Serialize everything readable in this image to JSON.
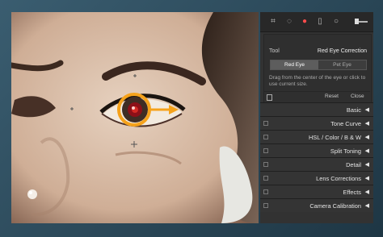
{
  "toolbar": {
    "icons": [
      "crop-grid-icon",
      "spot-removal-icon",
      "red-eye-icon",
      "graduated-filter-icon",
      "radial-filter-icon",
      "adjustment-brush-icon"
    ]
  },
  "tool": {
    "label": "Tool",
    "value": "Red Eye Correction",
    "modes": [
      "Red Eye",
      "Pet Eye"
    ],
    "help": "Drag from the center of the eye or click to use current size.",
    "reset": "Reset",
    "close": "Close"
  },
  "sections": [
    "Basic",
    "Tone Curve",
    "HSL  /  Color  /  B & W",
    "Split Toning",
    "Detail",
    "Lens Corrections",
    "Effects",
    "Camera Calibration"
  ],
  "colors": {
    "highlight": "#f5a21b",
    "panel": "#323232",
    "background": "#2a4a5c"
  }
}
